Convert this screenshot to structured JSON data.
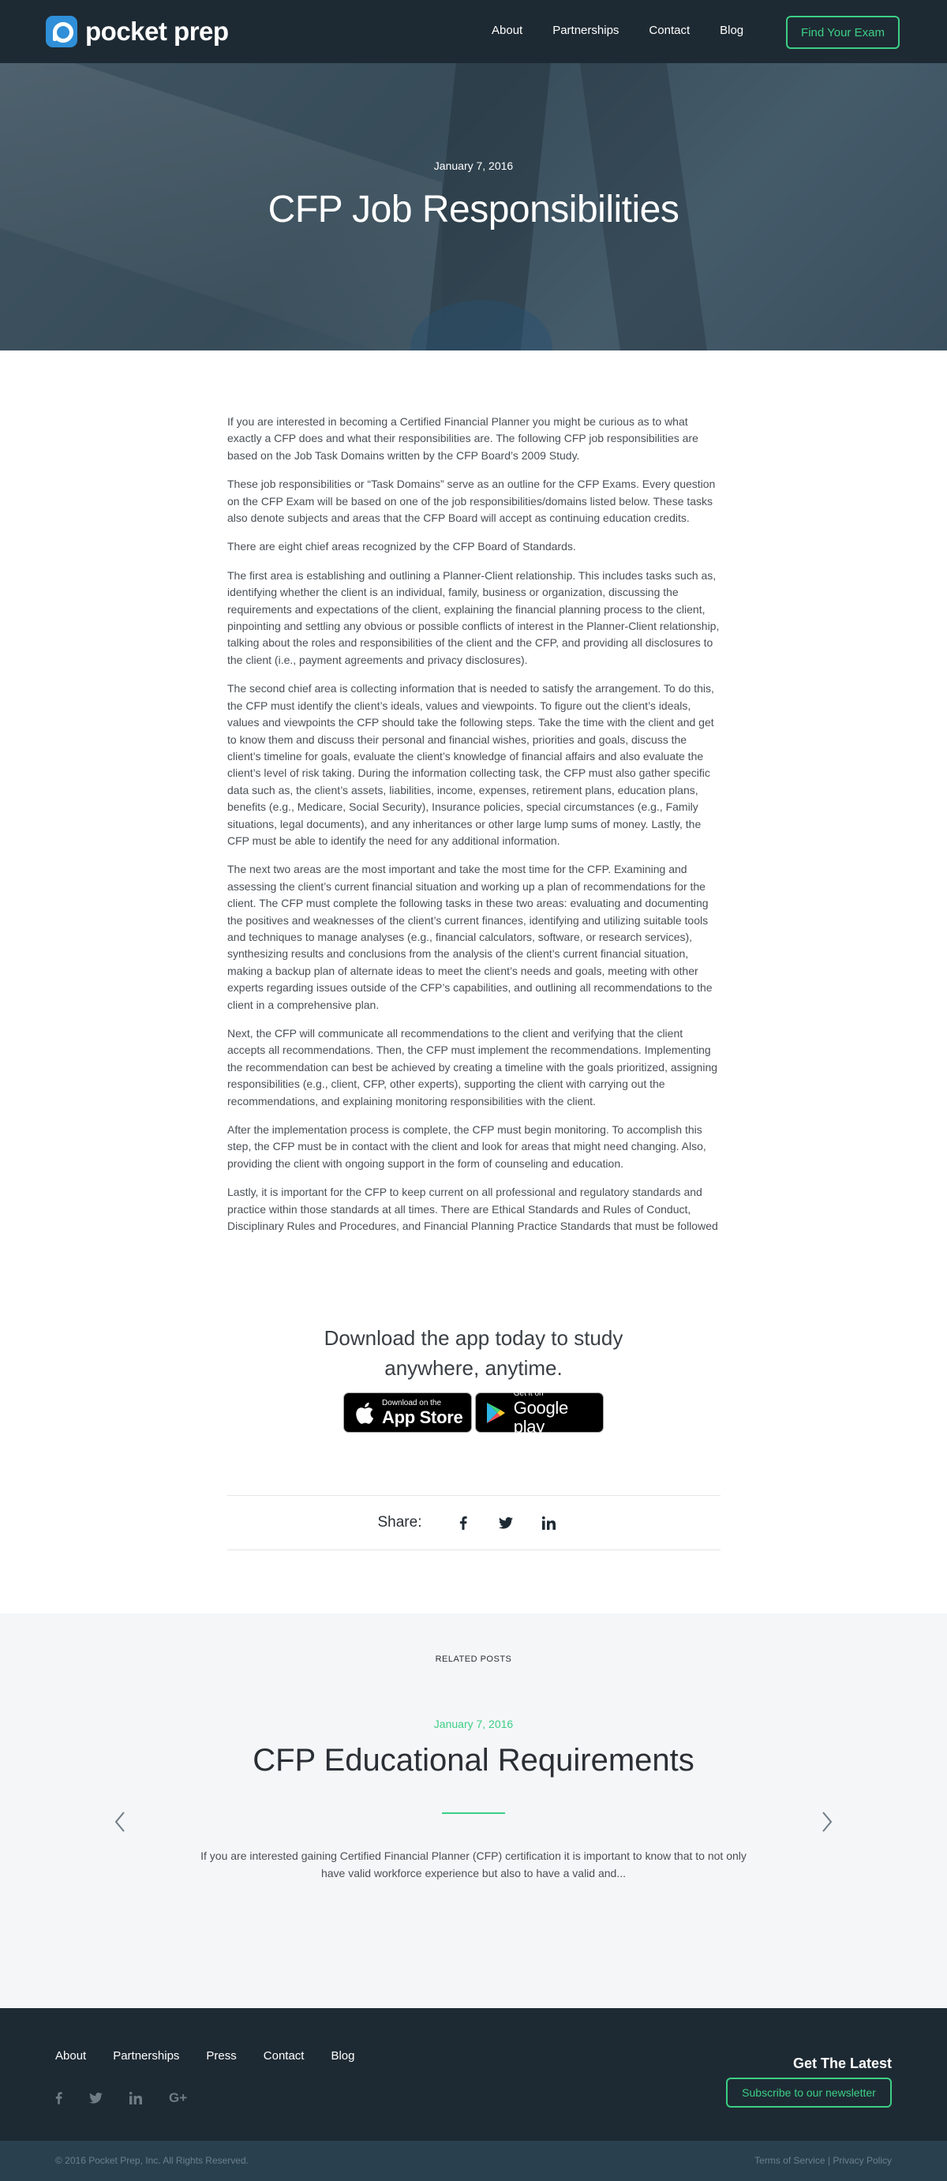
{
  "nav": {
    "logo_text": "pocket prep",
    "links": [
      "About",
      "Partnerships",
      "Contact",
      "Blog"
    ],
    "cta": "Find Your Exam"
  },
  "hero": {
    "date": "January 7, 2016",
    "title": "CFP Job Responsibilities"
  },
  "article": {
    "paragraphs": [
      "If you are interested in becoming a Certified Financial Planner you might be curious as to what exactly a CFP does and what their responsibilities are. The following CFP job responsibilities are based on the Job Task Domains written by the CFP Board’s 2009 Study.",
      "These job responsibilities or “Task Domains” serve as an outline for the CFP Exams. Every question on the CFP Exam will be based on one of the job responsibilities/domains listed below. These tasks also denote subjects and areas that the CFP Board will accept as continuing education credits.",
      "There are eight chief areas recognized by the CFP Board of Standards.",
      "The first area is establishing and outlining a Planner-Client relationship. This includes tasks such as, identifying whether the client is an individual, family, business or organization, discussing the requirements and expectations of the client, explaining the financial planning process to the client, pinpointing and settling any obvious or possible conflicts of interest in the Planner-Client relationship, talking about the roles and responsibilities of the client and the CFP, and providing all disclosures to the client (i.e., payment agreements and privacy disclosures).",
      "The second chief area is collecting information that is needed to satisfy the arrangement. To do this, the CFP must identify the client’s ideals, values and viewpoints. To figure out the client’s ideals, values and viewpoints the CFP should take the following steps. Take the time with the client and get to know them and discuss their personal and financial wishes, priorities and goals, discuss the client’s timeline for goals, evaluate the client’s knowledge of financial affairs and also evaluate the client’s level of risk taking. During the information collecting task, the CFP must also gather specific data such as, the client’s assets, liabilities, income, expenses, retirement plans, education plans, benefits (e.g., Medicare, Social Security), Insurance policies, special circumstances (e.g., Family situations, legal documents), and any inheritances or other large lump sums of money. Lastly, the CFP must be able to identify the need for any additional information.",
      "The next two areas are the most important and take the most time for the CFP. Examining and assessing the client’s current financial situation and working up a plan of recommendations for the client. The CFP must complete the following tasks in these two areas: evaluating and documenting the positives and weaknesses of the client’s current finances, identifying and utilizing suitable tools and techniques to manage analyses (e.g., financial calculators, software, or research services), synthesizing results and conclusions from the analysis of the client’s current financial situation, making a backup plan of alternate ideas to meet the client’s needs and goals, meeting with other experts regarding issues outside of the CFP’s capabilities, and outlining all recommendations to the client in a comprehensive plan.",
      "Next, the CFP will communicate all recommendations to the client and verifying that the client accepts all recommendations. Then, the CFP must implement the recommendations. Implementing the recommendation can best be achieved by creating a timeline with the goals prioritized, assigning responsibilities (e.g., client, CFP, other experts), supporting the client with carrying out the recommendations, and explaining monitoring responsibilities with the client.",
      "After the implementation process is complete, the CFP must begin monitoring. To accomplish this step, the CFP must be in contact with the client and look for areas that might need changing. Also, providing the client with ongoing support in the form of counseling and education.",
      "Lastly, it is important for the CFP to keep current on all professional and regulatory standards and practice within those standards at all times. There are Ethical Standards and Rules of Conduct, Disciplinary Rules and Procedures, and Financial Planning Practice Standards that must be followed"
    ]
  },
  "download": {
    "title_line1": "Download the app today to study",
    "title_line2": "anywhere, anytime.",
    "appstore_small": "Download on the",
    "appstore_big": "App Store",
    "gplay_small": "Get it on",
    "gplay_big": "Google play"
  },
  "share": {
    "label": "Share:"
  },
  "related": {
    "label": "RELATED POSTS",
    "date": "January 7, 2016",
    "title": "CFP Educational Requirements",
    "excerpt": "If you are interested gaining Certified Financial Planner (CFP) certification it is important to know that to not only have valid workforce experience but also to have a valid and..."
  },
  "footer": {
    "links": [
      "About",
      "Partnerships",
      "Press",
      "Contact",
      "Blog"
    ],
    "gplus": "G+",
    "get_latest": "Get The Latest",
    "subscribe": "Subscribe to our newsletter",
    "copyright": "© 2016 Pocket Prep, Inc. All Rights Reserved.",
    "terms": "Terms of Service",
    "separator": "|",
    "privacy": "Privacy Policy"
  },
  "colors": {
    "nav_bg": "#1e2a33",
    "accent_green": "#3ccf86",
    "brand_blue": "#2f8fd8",
    "related_bg": "#f5f6f8",
    "subfooter_bg": "#29404f"
  }
}
